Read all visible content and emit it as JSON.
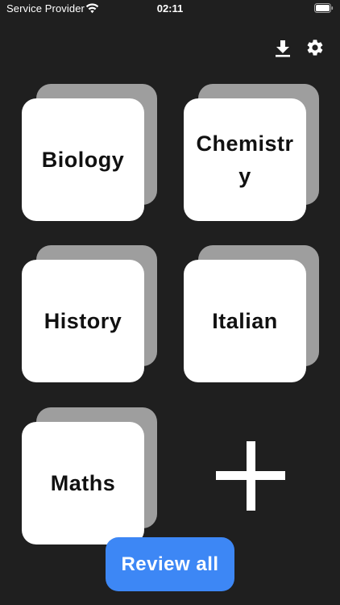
{
  "status_bar": {
    "carrier": "Service Provider",
    "time": "02:11",
    "wifi_icon": "wifi-icon",
    "battery_icon": "battery-full-icon"
  },
  "toolbar": {
    "download_icon": "download-icon",
    "settings_icon": "gear-icon"
  },
  "decks": [
    {
      "name": "Biology"
    },
    {
      "name": "Chemistry"
    },
    {
      "name": "History"
    },
    {
      "name": "Italian"
    },
    {
      "name": "Maths"
    }
  ],
  "add_deck_icon": "plus-icon",
  "review_all_label": "Review all",
  "colors": {
    "background": "#1f1f1f",
    "card_front": "#ffffff",
    "card_back": "#9e9e9e",
    "accent": "#3d87f5"
  }
}
